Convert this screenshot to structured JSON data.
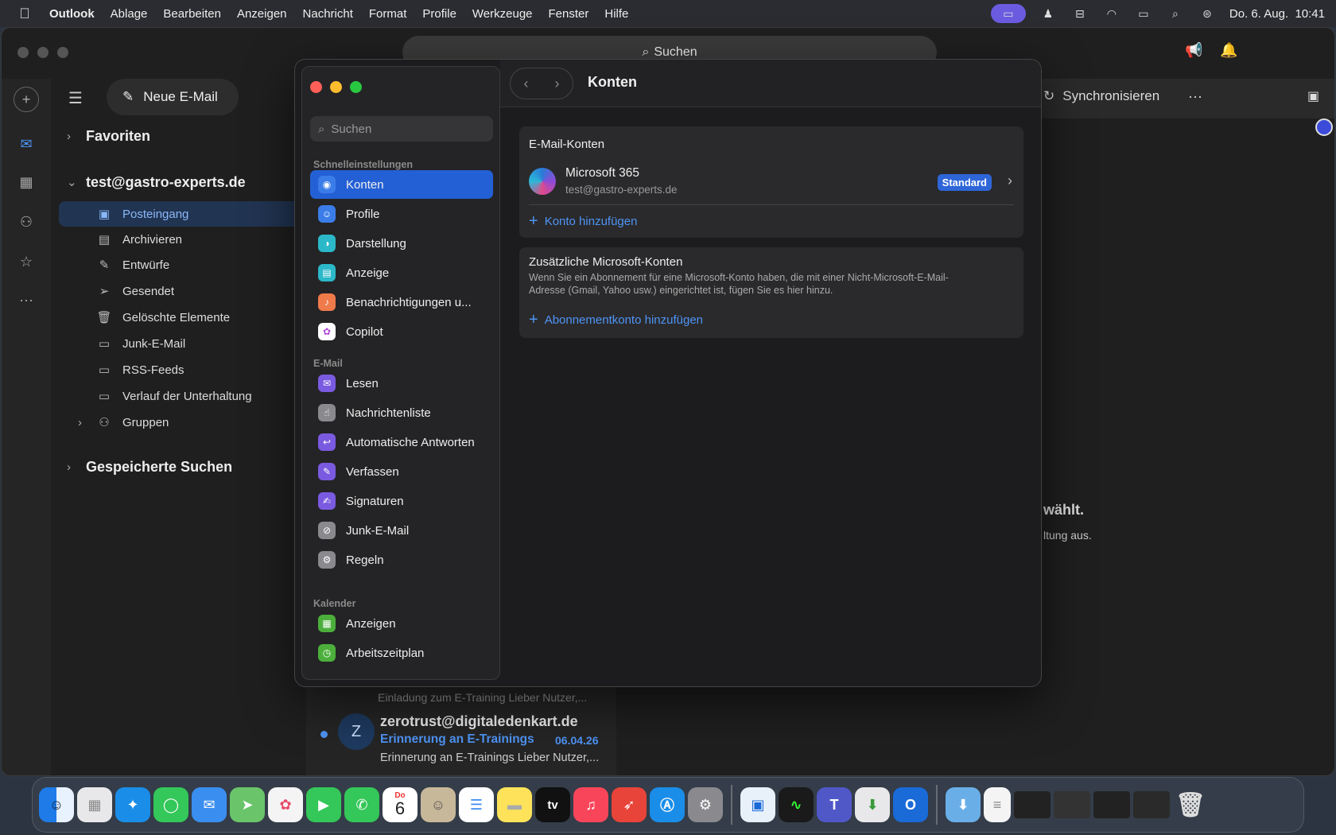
{
  "menubar": {
    "app": "Outlook",
    "items": [
      "Ablage",
      "Bearbeiten",
      "Anzeigen",
      "Nachricht",
      "Format",
      "Profile",
      "Werkzeuge",
      "Fenster",
      "Hilfe"
    ],
    "clock": "Do. 6. Aug.  10:41"
  },
  "outlook": {
    "search_label": "Suchen",
    "new_mail": "Neue E-Mail",
    "sync": "Synchronisieren",
    "favorites": "Favoriten",
    "account": "test@gastro-experts.de",
    "folders": [
      "Posteingang",
      "Archivieren",
      "Entwürfe",
      "Gesendet",
      "Gelöschte Elemente",
      "Junk-E-Mail",
      "RSS-Feeds",
      "Verlauf der Unterhaltung",
      "Gruppen"
    ],
    "saved_searches": "Gespeicherte Suchen",
    "peek_text1": "wählt.",
    "peek_text2": "ltung aus.",
    "messages": [
      {
        "preview": "Einladung zum E-Training Lieber Nutzer,..."
      },
      {
        "avatar": "Z",
        "sender": "zerotrust@digitaledenkart.de",
        "subject": "Erinnerung an E-Trainings",
        "date": "06.04.26",
        "preview": "Erinnerung an E-Trainings Lieber Nutzer,..."
      }
    ]
  },
  "settings": {
    "search_placeholder": "Suchen",
    "title": "Konten",
    "sections": [
      {
        "label": "Schnelleinstellungen",
        "items": [
          "Konten",
          "Profile",
          "Darstellung",
          "Anzeige",
          "Benachrichtigungen u...",
          "Copilot"
        ]
      },
      {
        "label": "E-Mail",
        "items": [
          "Lesen",
          "Nachrichtenliste",
          "Automatische Antworten",
          "Verfassen",
          "Signaturen",
          "Junk-E-Mail",
          "Regeln"
        ]
      },
      {
        "label": "Kalender",
        "items": [
          "Anzeigen",
          "Arbeitszeitplan"
        ]
      }
    ],
    "email_accounts": {
      "title": "E-Mail-Konten",
      "provider": "Microsoft 365",
      "address": "test@gastro-experts.de",
      "badge": "Standard",
      "add_link": "Konto hinzufügen"
    },
    "extra_accounts": {
      "title": "Zusätzliche Microsoft-Konten",
      "line1": "Wenn Sie ein Abonnement für eine Microsoft-Konto haben, die mit einer Nicht-Microsoft-E-Mail-",
      "line2": "Adresse (Gmail, Yahoo usw.) eingerichtet ist, fügen Sie es hier hinzu.",
      "add_link": "Abonnementkonto hinzufügen"
    }
  },
  "dock": {
    "calendar_month": "Do",
    "calendar_day": "6",
    "tv_label": "tv"
  }
}
